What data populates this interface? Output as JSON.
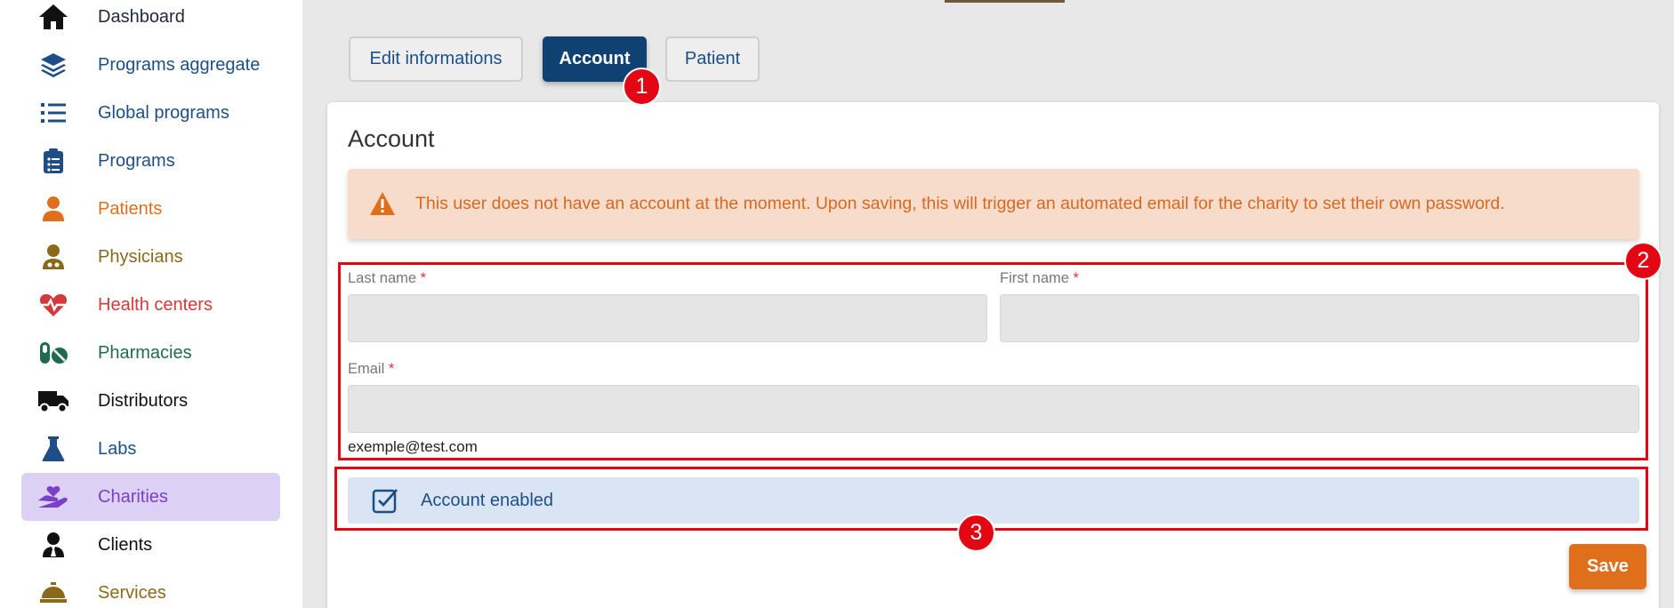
{
  "sidebar": {
    "items": [
      {
        "label": "Dashboard",
        "icon": "home-icon",
        "color": "#1f2937"
      },
      {
        "label": "Programs aggregate",
        "icon": "layers-icon",
        "color": "#1d4f86"
      },
      {
        "label": "Global programs",
        "icon": "list-icon",
        "color": "#1d4f86"
      },
      {
        "label": "Programs",
        "icon": "clipboard-list-icon",
        "color": "#1d4f86"
      },
      {
        "label": "Patients",
        "icon": "user-icon",
        "color": "#e06f1c"
      },
      {
        "label": "Physicians",
        "icon": "user-doctor-icon",
        "color": "#8a6a1a"
      },
      {
        "label": "Health centers",
        "icon": "heart-pulse-icon",
        "color": "#d33a3a"
      },
      {
        "label": "Pharmacies",
        "icon": "pills-icon",
        "color": "#1f6b4f"
      },
      {
        "label": "Distributors",
        "icon": "truck-icon",
        "color": "#111111"
      },
      {
        "label": "Labs",
        "icon": "flask-icon",
        "color": "#1d4f86"
      },
      {
        "label": "Charities",
        "icon": "hand-holding-heart-icon",
        "color": "#7b3fc9",
        "active": true
      },
      {
        "label": "Clients",
        "icon": "user-tie-icon",
        "color": "#111111"
      },
      {
        "label": "Services",
        "icon": "concierge-bell-icon",
        "color": "#8a6a1a"
      }
    ]
  },
  "tabs": [
    {
      "label": "Edit informations",
      "active": false
    },
    {
      "label": "Account",
      "active": true
    },
    {
      "label": "Patient",
      "active": false
    }
  ],
  "badges": [
    "1",
    "2",
    "3"
  ],
  "card": {
    "title": "Account",
    "alert": {
      "icon": "warning-triangle-icon",
      "text": "This user does not have an account at the moment. Upon saving, this will trigger an automated email for the charity to set their own password."
    },
    "form": {
      "last_name": {
        "label": "Last name",
        "required": "*",
        "value": ""
      },
      "first_name": {
        "label": "First name",
        "required": "*",
        "value": ""
      },
      "email": {
        "label": "Email",
        "required": "*",
        "value": "",
        "hint": "exemple@test.com"
      }
    },
    "account_enabled": {
      "label": "Account enabled",
      "checked": true,
      "icon": "checkbox-checked-icon"
    },
    "save_label": "Save"
  },
  "colors": {
    "primary": "#0f4173",
    "accent": "#e06f1c",
    "highlight": "#e30613",
    "active_nav_bg": "#ddd0f5"
  }
}
